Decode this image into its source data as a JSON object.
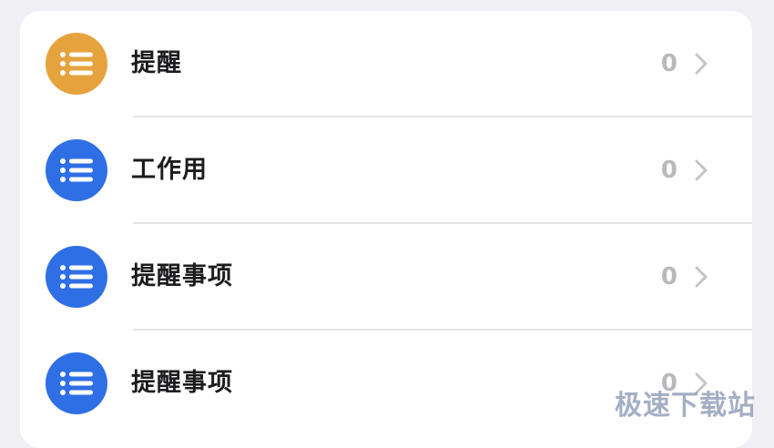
{
  "lists": [
    {
      "label": "提醒",
      "count": "0",
      "icon": "list-bullet-icon",
      "color": "#e6a23c"
    },
    {
      "label": "工作用",
      "count": "0",
      "icon": "list-bullet-icon",
      "color": "#2f6fe6"
    },
    {
      "label": "提醒事项",
      "count": "0",
      "icon": "list-bullet-icon",
      "color": "#2f6fe6"
    },
    {
      "label": "提醒事项",
      "count": "0",
      "icon": "list-bullet-icon",
      "color": "#2f6fe6"
    }
  ],
  "watermark": "极速下载站",
  "colors": {
    "background": "#efeff4",
    "card": "#ffffff",
    "label_text": "#1c1c1e",
    "count_text": "#b8b8bd",
    "separator": "#e4e4e8"
  }
}
